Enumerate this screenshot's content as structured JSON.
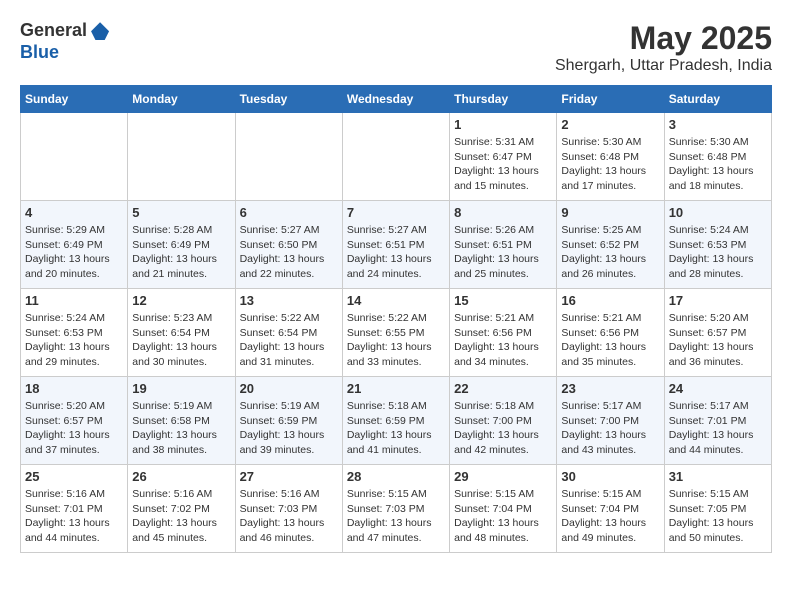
{
  "logo": {
    "general": "General",
    "blue": "Blue"
  },
  "header": {
    "month": "May 2025",
    "location": "Shergarh, Uttar Pradesh, India"
  },
  "days": [
    "Sunday",
    "Monday",
    "Tuesday",
    "Wednesday",
    "Thursday",
    "Friday",
    "Saturday"
  ],
  "weeks": [
    [
      {
        "date": "",
        "sunrise": "",
        "sunset": "",
        "daylight": ""
      },
      {
        "date": "",
        "sunrise": "",
        "sunset": "",
        "daylight": ""
      },
      {
        "date": "",
        "sunrise": "",
        "sunset": "",
        "daylight": ""
      },
      {
        "date": "",
        "sunrise": "",
        "sunset": "",
        "daylight": ""
      },
      {
        "date": "1",
        "sunrise": "Sunrise: 5:31 AM",
        "sunset": "Sunset: 6:47 PM",
        "daylight": "Daylight: 13 hours and 15 minutes."
      },
      {
        "date": "2",
        "sunrise": "Sunrise: 5:30 AM",
        "sunset": "Sunset: 6:48 PM",
        "daylight": "Daylight: 13 hours and 17 minutes."
      },
      {
        "date": "3",
        "sunrise": "Sunrise: 5:30 AM",
        "sunset": "Sunset: 6:48 PM",
        "daylight": "Daylight: 13 hours and 18 minutes."
      }
    ],
    [
      {
        "date": "4",
        "sunrise": "Sunrise: 5:29 AM",
        "sunset": "Sunset: 6:49 PM",
        "daylight": "Daylight: 13 hours and 20 minutes."
      },
      {
        "date": "5",
        "sunrise": "Sunrise: 5:28 AM",
        "sunset": "Sunset: 6:49 PM",
        "daylight": "Daylight: 13 hours and 21 minutes."
      },
      {
        "date": "6",
        "sunrise": "Sunrise: 5:27 AM",
        "sunset": "Sunset: 6:50 PM",
        "daylight": "Daylight: 13 hours and 22 minutes."
      },
      {
        "date": "7",
        "sunrise": "Sunrise: 5:27 AM",
        "sunset": "Sunset: 6:51 PM",
        "daylight": "Daylight: 13 hours and 24 minutes."
      },
      {
        "date": "8",
        "sunrise": "Sunrise: 5:26 AM",
        "sunset": "Sunset: 6:51 PM",
        "daylight": "Daylight: 13 hours and 25 minutes."
      },
      {
        "date": "9",
        "sunrise": "Sunrise: 5:25 AM",
        "sunset": "Sunset: 6:52 PM",
        "daylight": "Daylight: 13 hours and 26 minutes."
      },
      {
        "date": "10",
        "sunrise": "Sunrise: 5:24 AM",
        "sunset": "Sunset: 6:53 PM",
        "daylight": "Daylight: 13 hours and 28 minutes."
      }
    ],
    [
      {
        "date": "11",
        "sunrise": "Sunrise: 5:24 AM",
        "sunset": "Sunset: 6:53 PM",
        "daylight": "Daylight: 13 hours and 29 minutes."
      },
      {
        "date": "12",
        "sunrise": "Sunrise: 5:23 AM",
        "sunset": "Sunset: 6:54 PM",
        "daylight": "Daylight: 13 hours and 30 minutes."
      },
      {
        "date": "13",
        "sunrise": "Sunrise: 5:22 AM",
        "sunset": "Sunset: 6:54 PM",
        "daylight": "Daylight: 13 hours and 31 minutes."
      },
      {
        "date": "14",
        "sunrise": "Sunrise: 5:22 AM",
        "sunset": "Sunset: 6:55 PM",
        "daylight": "Daylight: 13 hours and 33 minutes."
      },
      {
        "date": "15",
        "sunrise": "Sunrise: 5:21 AM",
        "sunset": "Sunset: 6:56 PM",
        "daylight": "Daylight: 13 hours and 34 minutes."
      },
      {
        "date": "16",
        "sunrise": "Sunrise: 5:21 AM",
        "sunset": "Sunset: 6:56 PM",
        "daylight": "Daylight: 13 hours and 35 minutes."
      },
      {
        "date": "17",
        "sunrise": "Sunrise: 5:20 AM",
        "sunset": "Sunset: 6:57 PM",
        "daylight": "Daylight: 13 hours and 36 minutes."
      }
    ],
    [
      {
        "date": "18",
        "sunrise": "Sunrise: 5:20 AM",
        "sunset": "Sunset: 6:57 PM",
        "daylight": "Daylight: 13 hours and 37 minutes."
      },
      {
        "date": "19",
        "sunrise": "Sunrise: 5:19 AM",
        "sunset": "Sunset: 6:58 PM",
        "daylight": "Daylight: 13 hours and 38 minutes."
      },
      {
        "date": "20",
        "sunrise": "Sunrise: 5:19 AM",
        "sunset": "Sunset: 6:59 PM",
        "daylight": "Daylight: 13 hours and 39 minutes."
      },
      {
        "date": "21",
        "sunrise": "Sunrise: 5:18 AM",
        "sunset": "Sunset: 6:59 PM",
        "daylight": "Daylight: 13 hours and 41 minutes."
      },
      {
        "date": "22",
        "sunrise": "Sunrise: 5:18 AM",
        "sunset": "Sunset: 7:00 PM",
        "daylight": "Daylight: 13 hours and 42 minutes."
      },
      {
        "date": "23",
        "sunrise": "Sunrise: 5:17 AM",
        "sunset": "Sunset: 7:00 PM",
        "daylight": "Daylight: 13 hours and 43 minutes."
      },
      {
        "date": "24",
        "sunrise": "Sunrise: 5:17 AM",
        "sunset": "Sunset: 7:01 PM",
        "daylight": "Daylight: 13 hours and 44 minutes."
      }
    ],
    [
      {
        "date": "25",
        "sunrise": "Sunrise: 5:16 AM",
        "sunset": "Sunset: 7:01 PM",
        "daylight": "Daylight: 13 hours and 44 minutes."
      },
      {
        "date": "26",
        "sunrise": "Sunrise: 5:16 AM",
        "sunset": "Sunset: 7:02 PM",
        "daylight": "Daylight: 13 hours and 45 minutes."
      },
      {
        "date": "27",
        "sunrise": "Sunrise: 5:16 AM",
        "sunset": "Sunset: 7:03 PM",
        "daylight": "Daylight: 13 hours and 46 minutes."
      },
      {
        "date": "28",
        "sunrise": "Sunrise: 5:15 AM",
        "sunset": "Sunset: 7:03 PM",
        "daylight": "Daylight: 13 hours and 47 minutes."
      },
      {
        "date": "29",
        "sunrise": "Sunrise: 5:15 AM",
        "sunset": "Sunset: 7:04 PM",
        "daylight": "Daylight: 13 hours and 48 minutes."
      },
      {
        "date": "30",
        "sunrise": "Sunrise: 5:15 AM",
        "sunset": "Sunset: 7:04 PM",
        "daylight": "Daylight: 13 hours and 49 minutes."
      },
      {
        "date": "31",
        "sunrise": "Sunrise: 5:15 AM",
        "sunset": "Sunset: 7:05 PM",
        "daylight": "Daylight: 13 hours and 50 minutes."
      }
    ]
  ]
}
